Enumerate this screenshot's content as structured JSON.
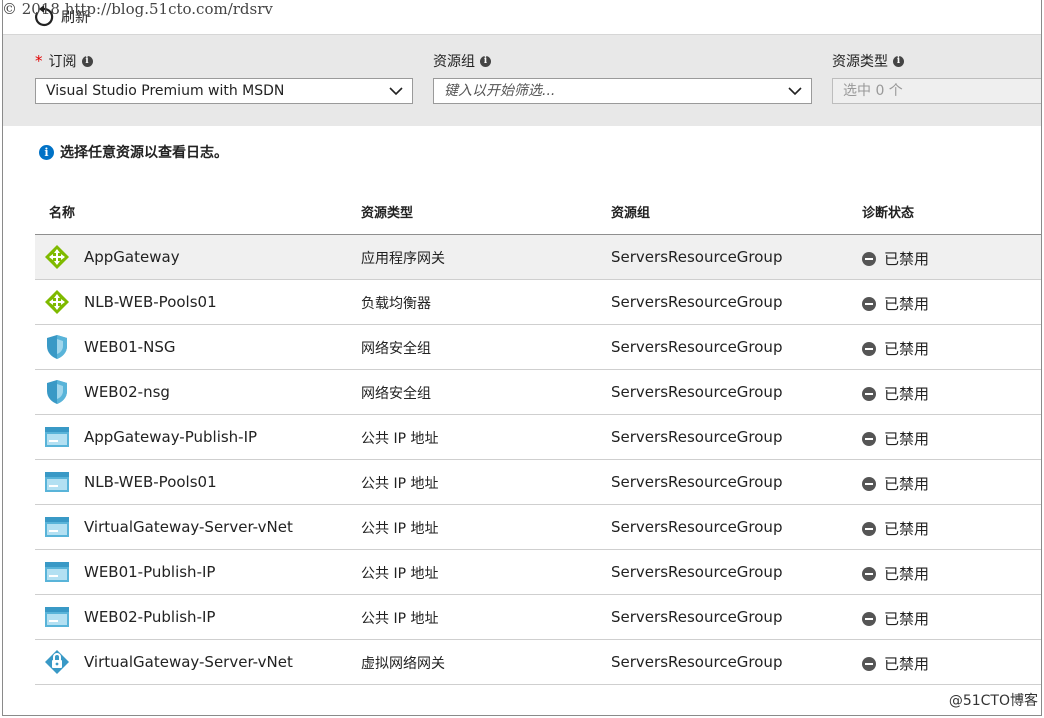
{
  "watermark_top": "© 2018 http://blog.51cto.com/rdsrv",
  "watermark_bottom": "@51CTO博客",
  "toolbar": {
    "refresh_label": "刷新"
  },
  "filters": {
    "subscription": {
      "required_mark": "*",
      "label": "订阅",
      "value": "Visual Studio Premium with MSDN"
    },
    "resource_group": {
      "label": "资源组",
      "placeholder": "键入以开始筛选..."
    },
    "resource_type": {
      "label": "资源类型",
      "value": "选中 0 个"
    }
  },
  "notice": "选择任意资源以查看日志。",
  "table": {
    "headers": {
      "name": "名称",
      "type": "资源类型",
      "group": "资源组",
      "status": "诊断状态"
    },
    "rows": [
      {
        "icon": "load-balancer-icon",
        "name": "AppGateway",
        "type": "应用程序网关",
        "group": "ServersResourceGroup",
        "status": "已禁用"
      },
      {
        "icon": "load-balancer-icon",
        "name": "NLB-WEB-Pools01",
        "type": "负载均衡器",
        "group": "ServersResourceGroup",
        "status": "已禁用"
      },
      {
        "icon": "shield-icon",
        "name": "WEB01-NSG",
        "type": "网络安全组",
        "group": "ServersResourceGroup",
        "status": "已禁用"
      },
      {
        "icon": "shield-icon",
        "name": "WEB02-nsg",
        "type": "网络安全组",
        "group": "ServersResourceGroup",
        "status": "已禁用"
      },
      {
        "icon": "public-ip-icon",
        "name": "AppGateway-Publish-IP",
        "type": "公共 IP 地址",
        "group": "ServersResourceGroup",
        "status": "已禁用"
      },
      {
        "icon": "public-ip-icon",
        "name": "NLB-WEB-Pools01",
        "type": "公共 IP 地址",
        "group": "ServersResourceGroup",
        "status": "已禁用"
      },
      {
        "icon": "public-ip-icon",
        "name": "VirtualGateway-Server-vNet",
        "type": "公共 IP 地址",
        "group": "ServersResourceGroup",
        "status": "已禁用"
      },
      {
        "icon": "public-ip-icon",
        "name": "WEB01-Publish-IP",
        "type": "公共 IP 地址",
        "group": "ServersResourceGroup",
        "status": "已禁用"
      },
      {
        "icon": "public-ip-icon",
        "name": "WEB02-Publish-IP",
        "type": "公共 IP 地址",
        "group": "ServersResourceGroup",
        "status": "已禁用"
      },
      {
        "icon": "vpn-gateway-icon",
        "name": "VirtualGateway-Server-vNet",
        "type": "虚拟网络网关",
        "group": "ServersResourceGroup",
        "status": "已禁用"
      }
    ]
  },
  "colors": {
    "accent": "#0072c6",
    "filter_bar": "#e8e8e8",
    "lb_green": "#7fba00"
  }
}
